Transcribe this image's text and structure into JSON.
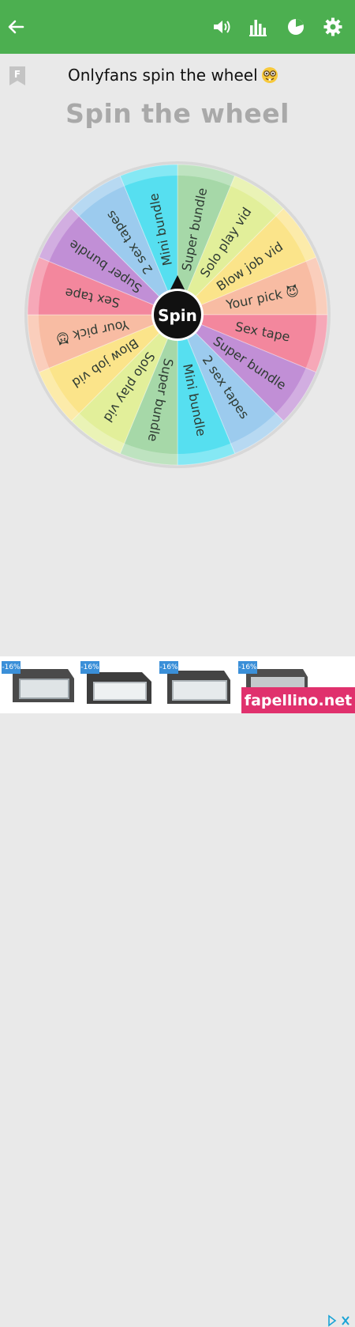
{
  "appbar": {
    "color": "#4caf50",
    "icons": [
      "back-arrow-icon",
      "volume-icon",
      "bar-chart-icon",
      "pie-chart-icon",
      "gear-icon"
    ]
  },
  "titlebar": {
    "title": "Onlyfans spin the wheel",
    "title_emoji": "nerd-face-icon",
    "bookmark_letter": "F"
  },
  "headline": "Spin the wheel",
  "wheel": {
    "center_label": "Spin",
    "segments": [
      {
        "label": "Super bundle",
        "color": "#a6d8a8"
      },
      {
        "label": "Solo play vid",
        "color": "#e2ef9a"
      },
      {
        "label": "Blow job vid",
        "color": "#fbe48a"
      },
      {
        "label": "Your pick 😈",
        "color": "#f8bca3"
      },
      {
        "label": "Sex tape",
        "color": "#f3879d"
      },
      {
        "label": "Super bundle",
        "color": "#c18fd6"
      },
      {
        "label": "2 sex tapes",
        "color": "#9ccbee"
      },
      {
        "label": "Mini bundle",
        "color": "#56dff0"
      },
      {
        "label": "Super bundle",
        "color": "#a6d8a8"
      },
      {
        "label": "Solo play vid",
        "color": "#e2ef9a"
      },
      {
        "label": "Blow job vid",
        "color": "#fbe48a"
      },
      {
        "label": "Your pick 😈",
        "color": "#f8bca3"
      },
      {
        "label": "Sex tape",
        "color": "#f3879d"
      },
      {
        "label": "Super bundle",
        "color": "#c18fd6"
      },
      {
        "label": "2 sex tapes",
        "color": "#9ccbee"
      },
      {
        "label": "Mini bundle",
        "color": "#56dff0"
      }
    ]
  },
  "ad": {
    "badges": [
      "-16%",
      "-16%",
      "-16%",
      "-16%"
    ],
    "watermark": "fapellino.net"
  }
}
